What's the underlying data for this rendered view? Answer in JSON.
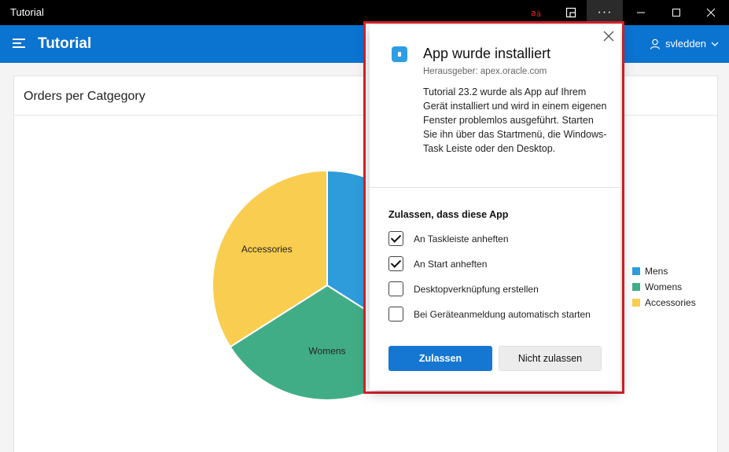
{
  "window": {
    "title": "Tutorial",
    "translate_icon": "translate-icon",
    "more_label": "···"
  },
  "header": {
    "title": "Tutorial",
    "user_name": "svledden",
    "accent_color": "#0b73d0"
  },
  "card": {
    "title": "Orders per Catgegory"
  },
  "chart_data": {
    "type": "pie",
    "labels": [
      "Mens",
      "Womens",
      "Accessories"
    ],
    "values": [
      34,
      32,
      34
    ],
    "colors": [
      "#2e9cdb",
      "#41ad86",
      "#f9cd4f"
    ],
    "slice_labels": [
      "",
      "Womens",
      "Accessories"
    ],
    "legend_position": "right"
  },
  "dialog": {
    "title": "App wurde installiert",
    "publisher": "Herausgeber: apex.oracle.com",
    "body": "Tutorial 23.2 wurde als App auf Ihrem Gerät installiert und wird in einem eigenen Fenster problemlos ausgeführt. Starten Sie ihn über das Startmenü, die Windows-Task Leiste oder den Desktop.",
    "allow_heading": "Zulassen, dass diese App",
    "options": [
      {
        "label": "An Taskleiste anheften",
        "checked": true
      },
      {
        "label": "An Start anheften",
        "checked": true
      },
      {
        "label": "Desktopverknüpfung erstellen",
        "checked": false
      },
      {
        "label": "Bei Geräteanmeldung automatisch starten",
        "checked": false
      }
    ],
    "allow_button": "Zulassen",
    "deny_button": "Nicht zulassen",
    "highlight_color": "#d7232d"
  }
}
